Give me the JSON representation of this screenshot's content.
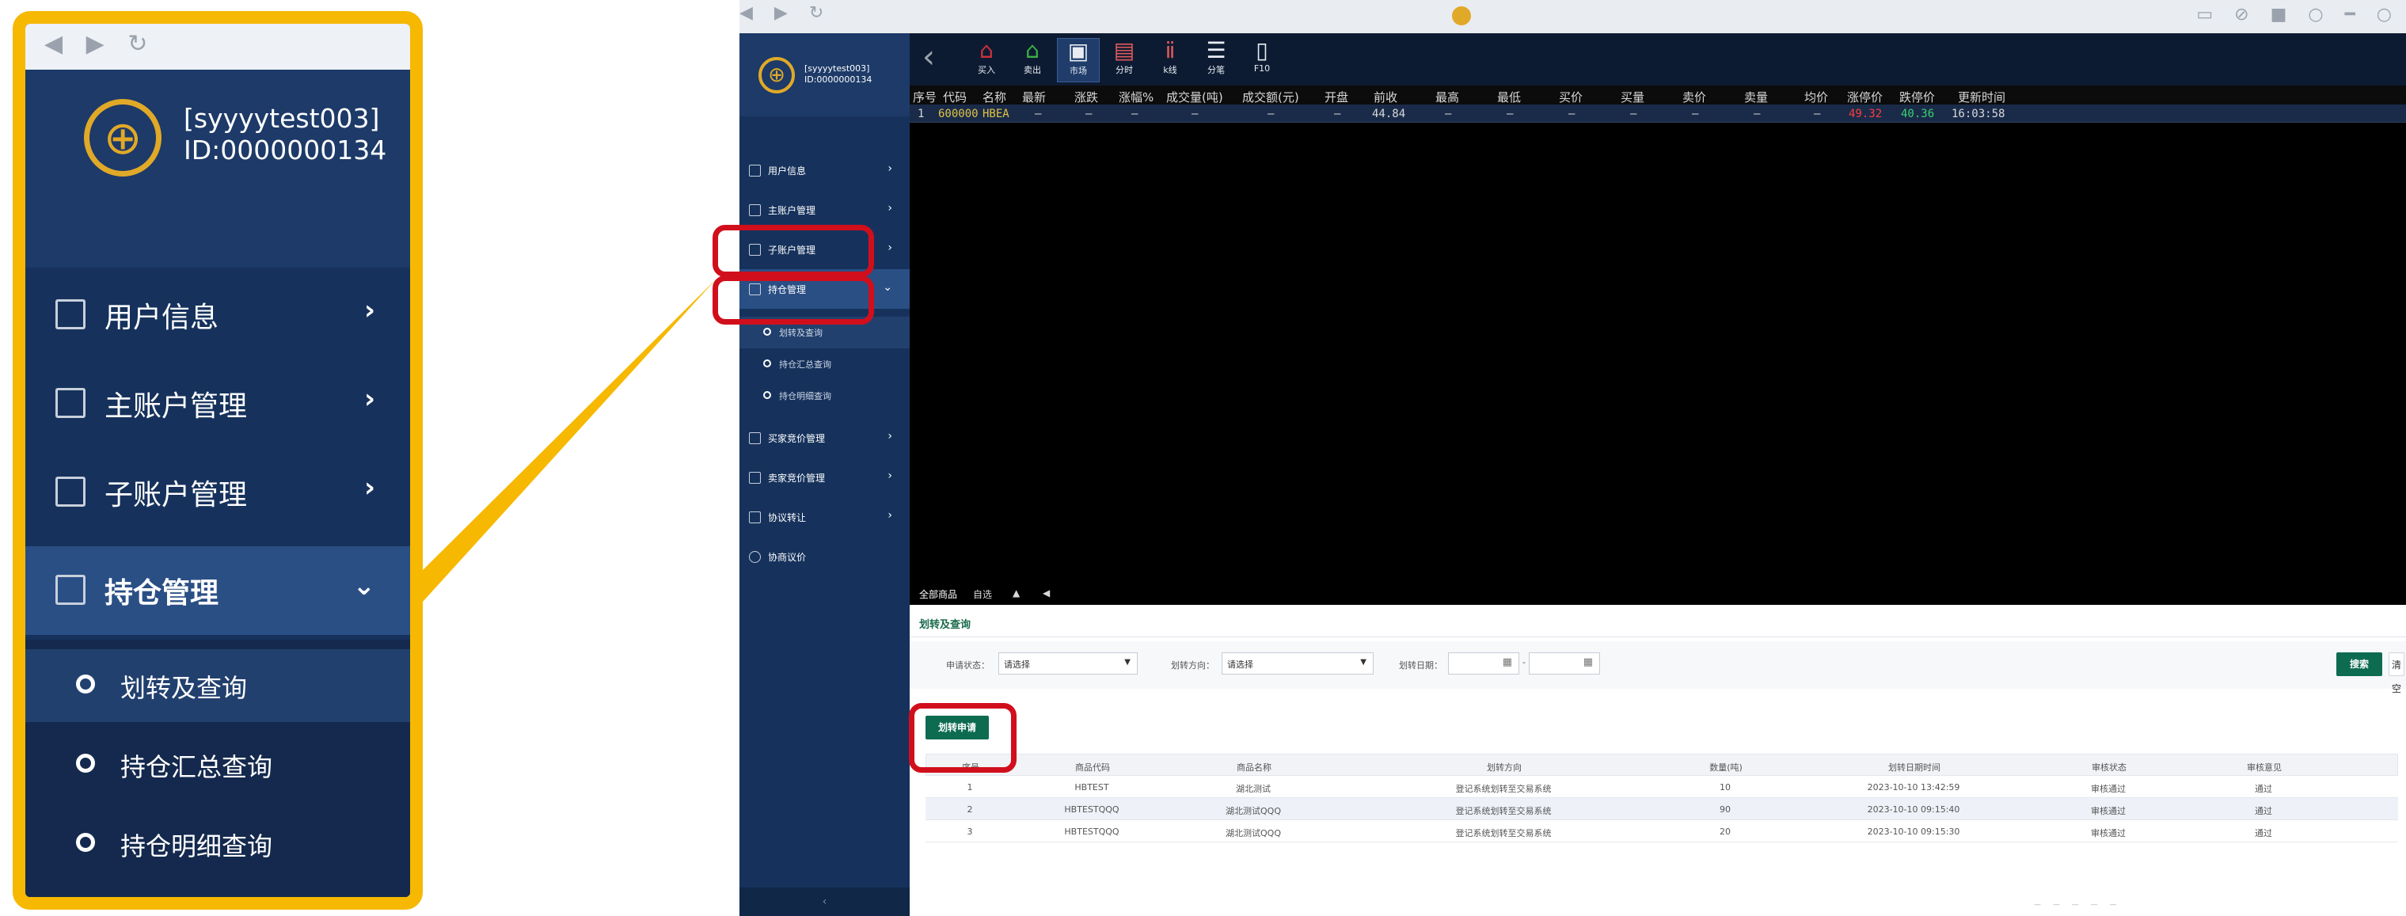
{
  "callout": {
    "nav_glyphs": "◀ ▶ ↻",
    "logo_glyph": "⊕",
    "user_line1": "[syyyytest003]",
    "user_line2": "ID:0000000134",
    "menu": [
      {
        "label": "用户信息",
        "chevron": "›"
      },
      {
        "label": "主账户管理",
        "chevron": "›"
      },
      {
        "label": "子账户管理",
        "chevron": "›"
      },
      {
        "label": "持仓管理",
        "chevron": "⌄"
      }
    ],
    "submenu": [
      "划转及查询",
      "持仓汇总查询",
      "持仓明细查询"
    ]
  },
  "browser": {
    "nav_glyphs": "◀ ▶ ↻",
    "title": "",
    "window_controls": "▭ ⊘ ■ ○ ━ ○"
  },
  "sidebar": {
    "user_line1": "[syyyytest003]",
    "user_line2": "ID:0000000134",
    "menu": [
      {
        "label": "用户信息",
        "chevron": "›"
      },
      {
        "label": "主账户管理",
        "chevron": "›"
      },
      {
        "label": "子账户管理",
        "chevron": "›"
      },
      {
        "label": "持仓管理",
        "chevron": "⌄"
      }
    ],
    "submenu": [
      "划转及查询",
      "持仓汇总查询",
      "持仓明细查询"
    ],
    "menu2": [
      {
        "label": "买家竞价管理",
        "chevron": "›"
      },
      {
        "label": "卖家竞价管理",
        "chevron": "›"
      },
      {
        "label": "协议转让",
        "chevron": "›"
      },
      {
        "label": "协商议价",
        "chevron": ""
      }
    ],
    "footer_glyph": "‹"
  },
  "toolbar": {
    "back_glyph": "‹",
    "buttons": [
      {
        "label": "买入",
        "glyph": "⌂",
        "color": "#d0313c"
      },
      {
        "label": "卖出",
        "glyph": "⌂",
        "color": "#3cb043"
      },
      {
        "label": "市场",
        "glyph": "▣",
        "color": "#e8ecf2"
      },
      {
        "label": "分时",
        "glyph": "▤",
        "color": "#e05a5a"
      },
      {
        "label": "k线",
        "glyph": "ⅱ",
        "color": "#e05a5a"
      },
      {
        "label": "分笔",
        "glyph": "☰",
        "color": "#e8ecf2"
      },
      {
        "label": "F10",
        "glyph": "▯",
        "color": "#e8ecf2"
      }
    ]
  },
  "quote_grid": {
    "headers": [
      "序号",
      "代码",
      "名称",
      "最新",
      "涨跌",
      "涨幅%",
      "成交量(吨)",
      "成交额(元)",
      "开盘",
      "前收",
      "最高",
      "最低",
      "买价",
      "买量",
      "卖价",
      "卖量",
      "均价",
      "涨停价",
      "跌停价",
      "更新时间"
    ],
    "rows": [
      [
        "1",
        "600000",
        "HBEA",
        "—",
        "—",
        "—",
        "—",
        "—",
        "—",
        "44.84",
        "—",
        "—",
        "—",
        "—",
        "—",
        "—",
        "—",
        "49.32",
        "40.36",
        "16:03:58"
      ]
    ],
    "colors": {
      "code": "#e0c342",
      "limit_up": "#ff3b3b",
      "limit_down": "#3bd16f",
      "default": "#d8d8d8"
    }
  },
  "bottom_tabs": [
    "全部商品",
    "自选",
    "▲",
    "◀"
  ],
  "panel": {
    "title": "划转及查询",
    "filters": {
      "status_label": "申请状态：",
      "status_value": "请选择",
      "direction_label": "划转方向：",
      "direction_value": "请选择",
      "date_label": "划转日期：",
      "date_sep": "-",
      "date_icon": "▦"
    },
    "search_button": "搜索",
    "clear_button": "清空",
    "apply_button": "划转申请"
  },
  "transfer_table": {
    "headers": [
      "序号",
      "商品代码",
      "商品名称",
      "划转方向",
      "数量(吨)",
      "划转日期时间",
      "审核状态",
      "审核意见"
    ],
    "rows": [
      [
        "1",
        "HBTEST",
        "湖北测试",
        "登记系统划转至交易系统",
        "10",
        "2023-10-10 13:42:59",
        "审核通过",
        "通过"
      ],
      [
        "2",
        "HBTESTQQQ",
        "湖北测试QQQ",
        "登记系统划转至交易系统",
        "90",
        "2023-10-10 09:15:40",
        "审核通过",
        "通过"
      ],
      [
        "3",
        "HBTESTQQQ",
        "湖北测试QQQ",
        "登记系统划转至交易系统",
        "20",
        "2023-10-10 09:15:30",
        "审核通过",
        "通过"
      ]
    ]
  },
  "pager": "— — — — —",
  "highlight_color": "#d10f1c",
  "callout_color": "#f6b800"
}
